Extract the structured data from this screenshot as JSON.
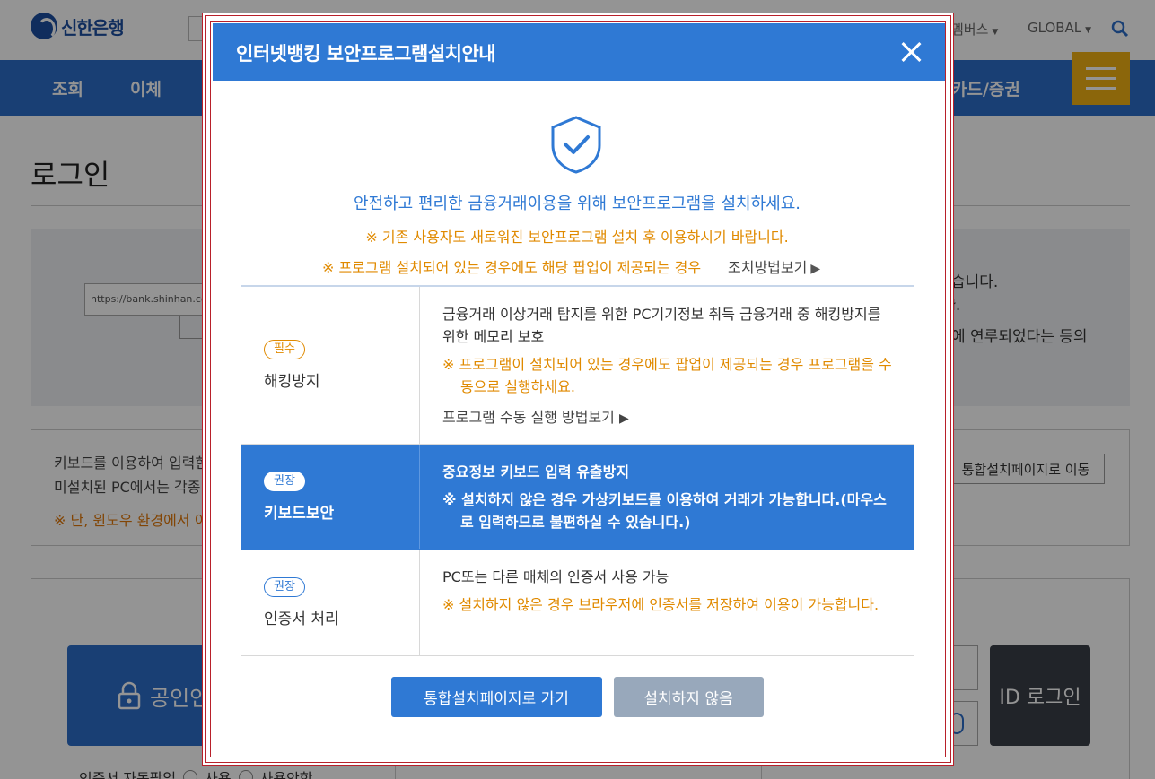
{
  "site": {
    "logo_text": "신한은행",
    "util_members": "멤버스",
    "util_global": "GLOBAL",
    "gnb": [
      "조회",
      "이체",
      "카드/증권"
    ]
  },
  "page": {
    "title": "로그인",
    "url_illustration": "https://bank.shinhan.com",
    "notice_lines": [
      "습니다.",
      "ł.",
      "에 연루되었다는 등의"
    ],
    "keyboard_notice": {
      "line1": "키보드를 이용하여 입력한",
      "line2": "미설치된 PC에서는 각종",
      "warn": "※ 단, 윈도우 환경에서 이",
      "button": "통합설치페이지로 이동"
    },
    "cert_login": "공인인",
    "id_login": "ID 로그인",
    "auto_popup_label": "인증서 자동팝업",
    "auto_popup_on": "사용",
    "auto_popup_off": "사용안함"
  },
  "modal": {
    "title": "인터넷뱅킹 보안프로그램설치안내",
    "intro_main": "안전하고 편리한 금융거래이용을 위해 보안프로그램을 설치하세요.",
    "intro_warn1": "※ 기존 사용자도 새로워진 보안프로그램 설치 후 이용하시기 바랍니다.",
    "intro_warn2": "※ 프로그램 설치되어 있는 경우에도 해당 팝업이 제공되는 경우",
    "fix_link": "조치방법보기",
    "programs": [
      {
        "badge": "필수",
        "name": "해킹방지",
        "desc": "금융거래 이상거래 탐지를 위한 PC기기정보 취득 금융거래 중 해킹방지를 위한 메모리 보호",
        "warn": "※ 프로그램이 설치되어 있는 경우에도 팝업이 제공되는 경우 프로그램을 수동으로 실행하세요.",
        "link": "프로그램 수동 실행 방법보기"
      },
      {
        "badge": "권장",
        "name": "키보드보안",
        "desc": "중요정보 키보드 입력 유출방지",
        "warn": "※ 설치하지 않은 경우 가상키보드를 이용하여 거래가 가능합니다.(마우스로 입력하므로 불편하실 수 있습니다.)"
      },
      {
        "badge": "권장",
        "name": "인증서 처리",
        "desc": "PC또는 다른 매체의 인증서 사용 가능",
        "warn": "※ 설치하지 않은 경우 브라우저에 인증서를 저장하여 이용이 가능합니다."
      }
    ],
    "btn_install": "통합설치페이지로 가기",
    "btn_skip": "설치하지 않음"
  },
  "colors": {
    "primary": "#2f79d4",
    "warn": "#e08a00",
    "menu_button": "#f0b014",
    "frame_border": "#b8202a"
  },
  "icons": [
    "shield-check-icon",
    "close-icon",
    "search-icon",
    "hamburger-menu-icon",
    "lock-icon",
    "mouse-icon",
    "triangle-right-icon"
  ]
}
